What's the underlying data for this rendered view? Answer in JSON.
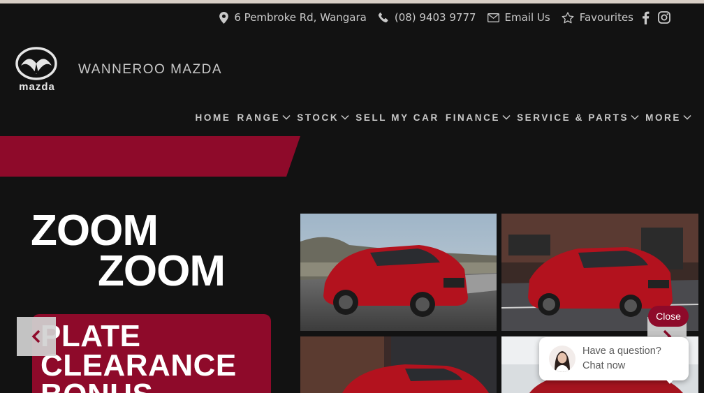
{
  "topbar": {
    "address": "6 Pembroke Rd, Wangara",
    "phone": "(08) 9403 9777",
    "email": "Email Us",
    "favourites": "Favourites",
    "icons": [
      "location-pin-icon",
      "phone-icon",
      "envelope-icon",
      "star-icon",
      "facebook-icon",
      "instagram-icon"
    ]
  },
  "brand": {
    "logo_text": "mazda",
    "dealer_name": "WANNEROO MAZDA"
  },
  "nav": {
    "items": [
      {
        "label": "HOME",
        "dropdown": false
      },
      {
        "label": "RANGE",
        "dropdown": true
      },
      {
        "label": "STOCK",
        "dropdown": true
      },
      {
        "label": "SELL MY CAR",
        "dropdown": false
      },
      {
        "label": "FINANCE",
        "dropdown": true
      },
      {
        "label": "SERVICE & PARTS",
        "dropdown": true
      },
      {
        "label": "MORE",
        "dropdown": true
      }
    ]
  },
  "hero": {
    "headline_line1": "ZOOM",
    "headline_line2": "ZOOM",
    "promo_line1": "PLATE",
    "promo_line2": "CLEARANCE",
    "promo_line3": "BONUS"
  },
  "chat": {
    "close_label": "Close",
    "line1": "Have a question?",
    "line2": "Chat now"
  },
  "colors": {
    "background": "#121212",
    "brand_red": "#8e0a2a",
    "text_light": "#c9c9c9"
  }
}
